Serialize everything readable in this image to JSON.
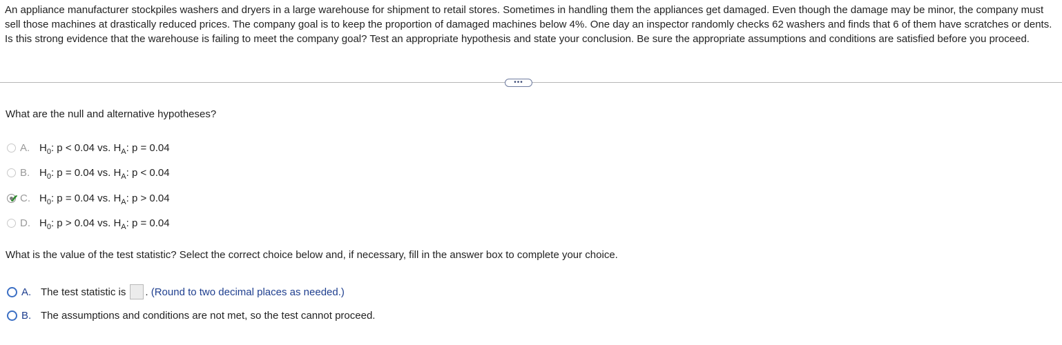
{
  "problem_text": "An appliance manufacturer stockpiles washers and dryers in a large warehouse for shipment to retail stores. Sometimes in handling them the appliances get damaged. Even though the damage may be minor, the company must sell those machines at drastically reduced prices. The company goal is to keep the proportion of damaged machines below 4%. One day an inspector randomly checks 62 washers and finds that 6 of them have scratches or dents. Is this strong evidence that the warehouse is failing to meet the company goal? Test an appropriate hypothesis and state your conclusion. Be sure the appropriate assumptions and conditions are satisfied before you proceed.",
  "more_button": "•••",
  "q1": {
    "prompt": "What are the null and alternative hypotheses?",
    "selected": "C",
    "choices": [
      {
        "letter": "A.",
        "h0_sym": "H",
        "h0_sub": "0",
        "h0_rel": ": p < 0.04 vs. ",
        "ha_sym": "H",
        "ha_sub": "A",
        "ha_rel": ": p = 0.04"
      },
      {
        "letter": "B.",
        "h0_sym": "H",
        "h0_sub": "0",
        "h0_rel": ": p = 0.04 vs. ",
        "ha_sym": "H",
        "ha_sub": "A",
        "ha_rel": ": p < 0.04"
      },
      {
        "letter": "C.",
        "h0_sym": "H",
        "h0_sub": "0",
        "h0_rel": ": p = 0.04 vs. ",
        "ha_sym": "H",
        "ha_sub": "A",
        "ha_rel": ": p > 0.04"
      },
      {
        "letter": "D.",
        "h0_sym": "H",
        "h0_sub": "0",
        "h0_rel": ": p > 0.04 vs. ",
        "ha_sym": "H",
        "ha_sub": "A",
        "ha_rel": ": p = 0.04"
      }
    ]
  },
  "q2": {
    "prompt": "What is the value of the test statistic? Select the correct choice below and, if necessary, fill in the answer box to complete your choice.",
    "choice_a": {
      "letter": "A.",
      "text": "The test statistic is",
      "after_box": ".",
      "note": "(Round to two decimal places as needed.)",
      "input_value": ""
    },
    "choice_b": {
      "letter": "B.",
      "text": "The assumptions and conditions are not met, so the test cannot proceed."
    }
  },
  "colors": {
    "accent_blue": "#3b6fc4",
    "check_green": "#2e8b2e",
    "divider": "#b5b5b5"
  }
}
